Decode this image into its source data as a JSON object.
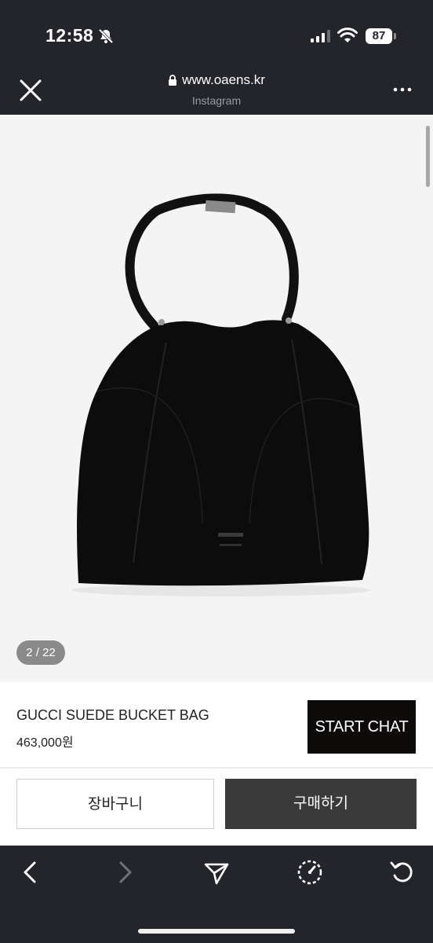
{
  "status_bar": {
    "time": "12:58",
    "battery": "87",
    "icons": [
      "bell-slash-icon",
      "signal-icon",
      "wifi-icon",
      "battery-icon"
    ]
  },
  "browser": {
    "url": "www.oaens.kr",
    "subtitle": "Instagram",
    "icons": [
      "close-icon",
      "lock-icon",
      "more-icon"
    ]
  },
  "gallery": {
    "counter": "2 / 22",
    "image": "black-suede-bucket-bag-photo"
  },
  "product": {
    "title": "GUCCI SUEDE BUCKET BAG",
    "price": "463,000원",
    "chat_label": "START CHAT"
  },
  "actions": {
    "cart_label": "장바구니",
    "buy_label": "구매하기"
  },
  "toolbar": {
    "icons": [
      "back-icon",
      "forward-icon",
      "share-icon",
      "compass-icon",
      "reload-icon"
    ]
  }
}
